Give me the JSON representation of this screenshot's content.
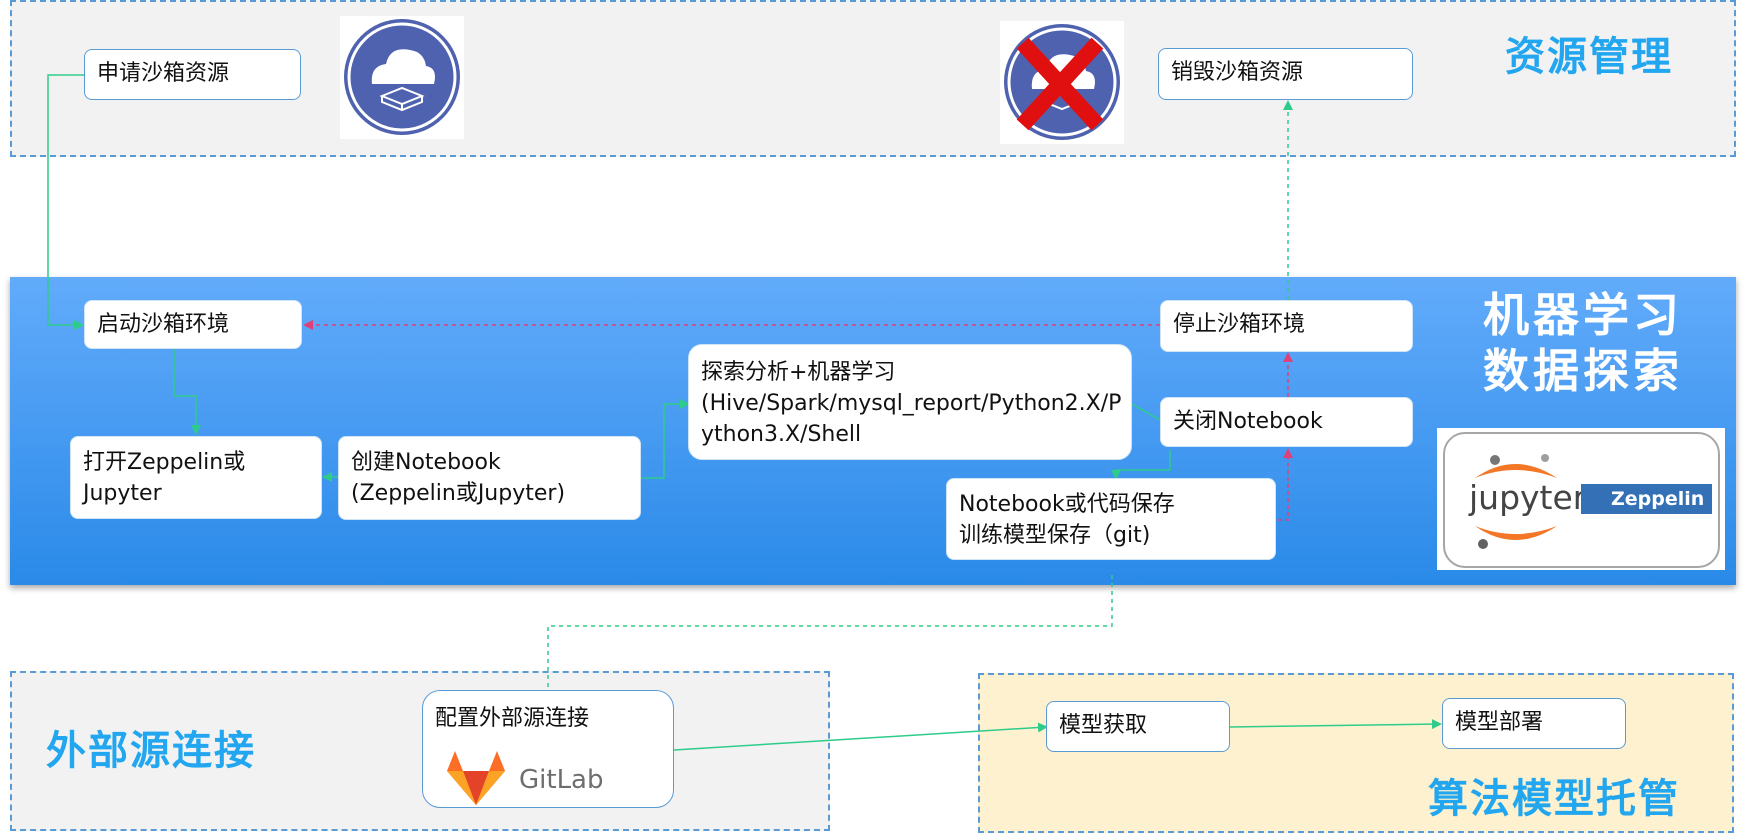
{
  "zones": {
    "resource": "资源管理",
    "ml_line1": "机器学习",
    "ml_line2": "数据探索",
    "external": "外部源连接",
    "algorithm": "算法模型托管"
  },
  "nodes": {
    "apply_sandbox": "申请沙箱资源",
    "destroy_sandbox": "销毁沙箱资源",
    "start_sandbox": "启动沙箱环境",
    "stop_sandbox": "停止沙箱环境",
    "open_zeppelin_l1": "打开Zeppelin或",
    "open_zeppelin_l2": "Jupyter",
    "create_notebook_l1": "创建Notebook",
    "create_notebook_l2": "(Zeppelin或Jupyter)",
    "explore_l1": "探索分析+机器学习",
    "explore_l2": "(Hive/Spark/mysql_report/Python2.X/P",
    "explore_l3": "ython3.X/Shell",
    "close_notebook": "关闭Notebook",
    "save_l1": "Notebook或代码保存",
    "save_l2": "训练模型保存（git)",
    "config_external": "配置外部源连接",
    "model_fetch": "模型获取",
    "model_deploy": "模型部署"
  },
  "logos": {
    "jupyter": "jupyter",
    "zeppelin": "Zeppelin",
    "gitlab": "GitLab"
  },
  "colors": {
    "zone_border": "#5b9bd5",
    "title_blue": "#22a6ef",
    "arrow_green": "#2ecc8a",
    "arrow_pink": "#e0407a",
    "cancel_red": "#e01010"
  }
}
